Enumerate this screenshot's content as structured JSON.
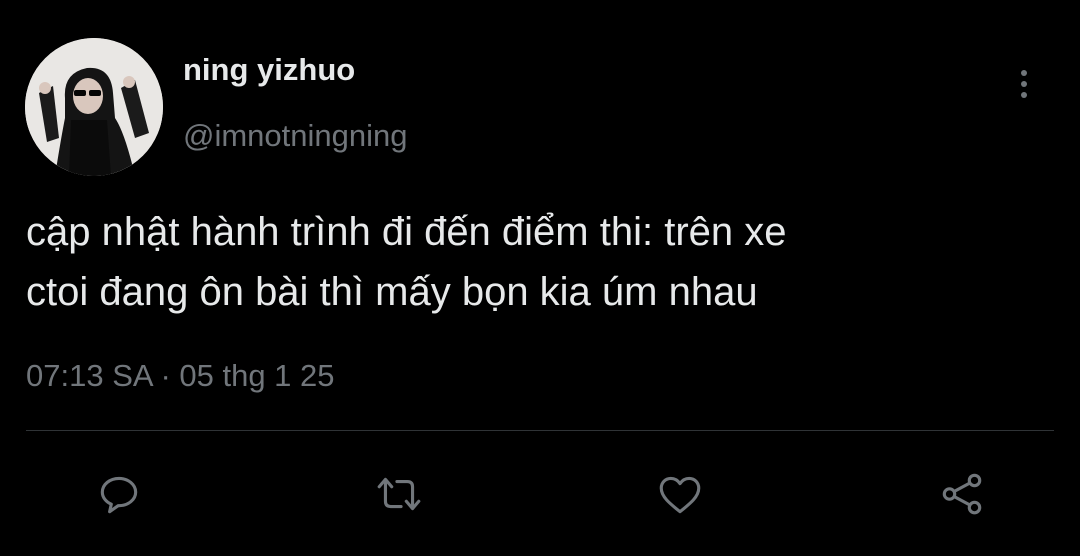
{
  "tweet": {
    "display_name": "ning yizhuo",
    "handle": "@imnotningning",
    "text_lines": [
      "cập nhật hành trình đi đến điểm thi: trên xe",
      "ctoi đang ôn bài thì mấy bọn kia úm nhau"
    ],
    "timestamp": "07:13 SA · 05 thg 1 25"
  },
  "icons": {
    "more": "more-vertical-icon",
    "reply": "reply-icon",
    "retweet": "retweet-icon",
    "like": "heart-icon",
    "share": "share-icon"
  },
  "colors": {
    "background": "#000000",
    "primary_text": "#e7e9ea",
    "secondary_text": "#71767b",
    "divider": "#2f3336"
  }
}
